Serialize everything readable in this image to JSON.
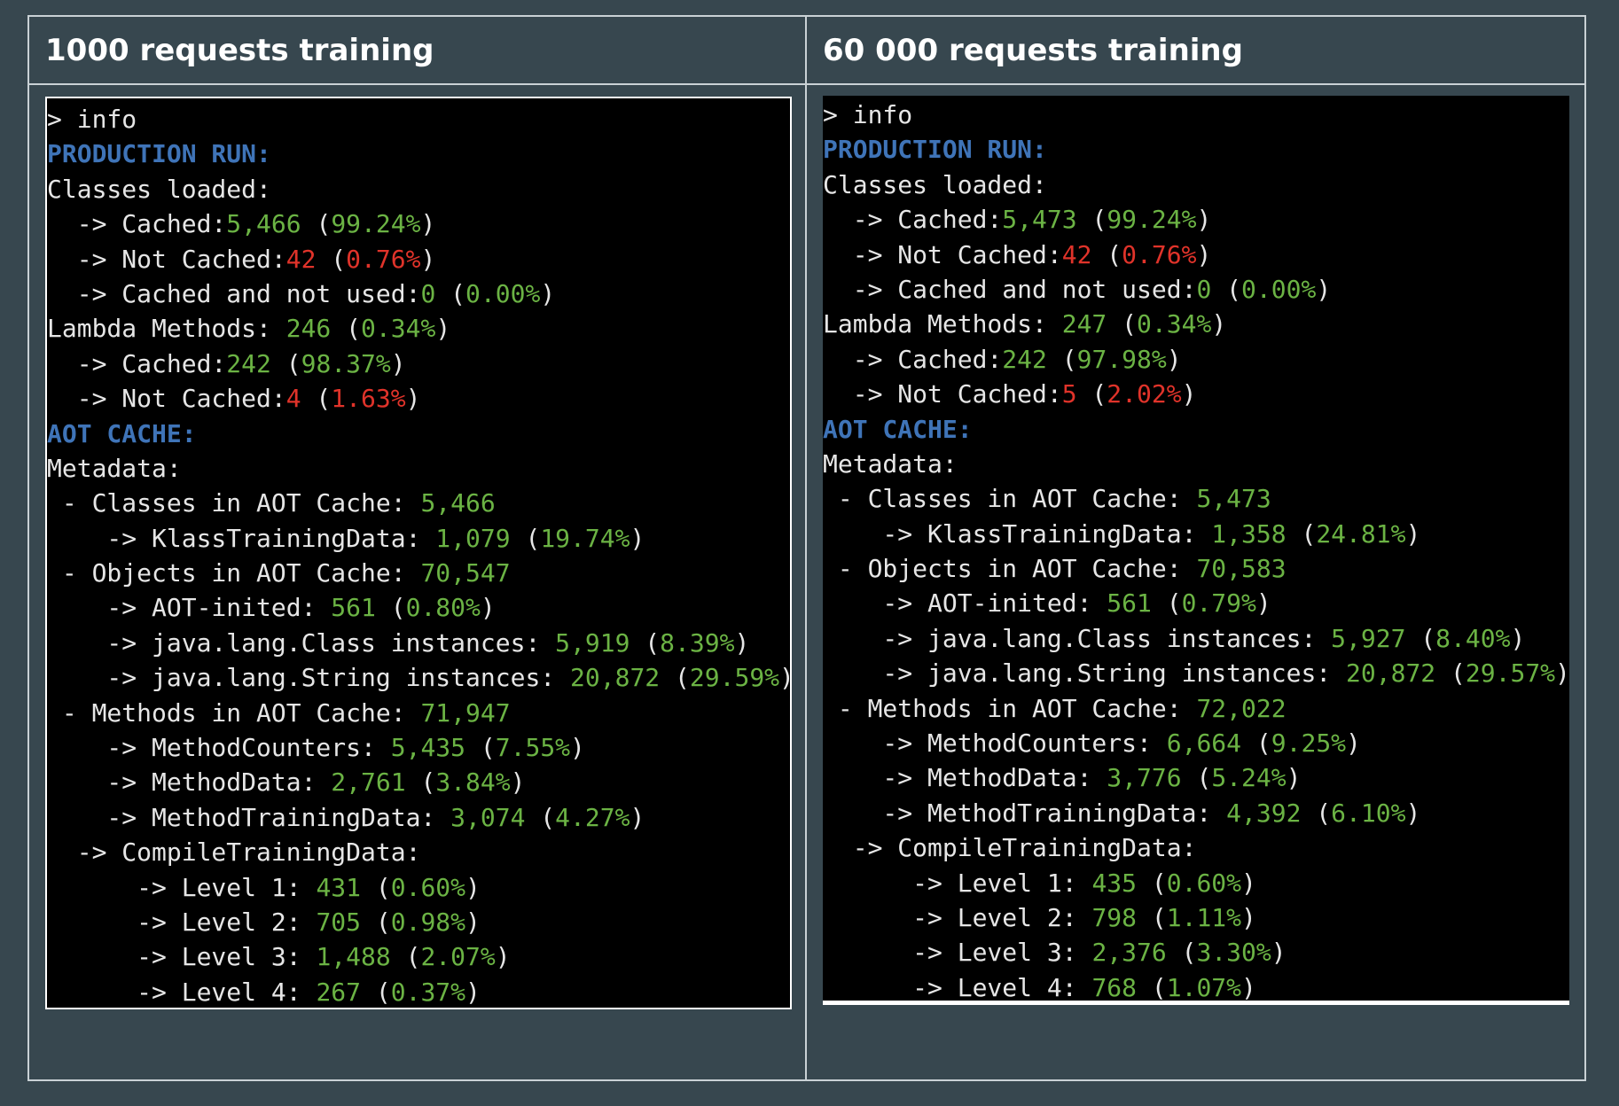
{
  "columns": [
    {
      "header": "1000 requests training",
      "terminal": {
        "prompt": "> info",
        "production_run_heading": "PRODUCTION RUN:",
        "classes_loaded_label": "Classes loaded:",
        "classes_cached_label": "  -> Cached:",
        "classes_cached_value": "5,466",
        "classes_cached_pct": "99.24%",
        "classes_not_cached_label": "  -> Not Cached:",
        "classes_not_cached_value": "42",
        "classes_not_cached_pct": "0.76%",
        "classes_cached_not_used_label": "  -> Cached and not used:",
        "classes_cached_not_used_value": "0",
        "classes_cached_not_used_pct": "0.00%",
        "lambda_label": "Lambda Methods: ",
        "lambda_value": "246",
        "lambda_pct": "0.34%",
        "lambda_cached_label": "  -> Cached:",
        "lambda_cached_value": "242",
        "lambda_cached_pct": "98.37%",
        "lambda_not_cached_label": "  -> Not Cached:",
        "lambda_not_cached_value": "4",
        "lambda_not_cached_pct": "1.63%",
        "aot_cache_heading": "AOT CACHE:",
        "metadata_label": "Metadata:",
        "classes_in_cache_label": " - Classes in AOT Cache: ",
        "classes_in_cache_value": "5,466",
        "klass_training_label": "    -> KlassTrainingData: ",
        "klass_training_value": "1,079",
        "klass_training_pct": "19.74%",
        "objects_in_cache_label": " - Objects in AOT Cache: ",
        "objects_in_cache_value": "70,547",
        "aot_inited_label": "    -> AOT-inited: ",
        "aot_inited_value": "561",
        "aot_inited_pct": "0.80%",
        "class_instances_label": "    -> java.lang.Class instances: ",
        "class_instances_value": "5,919",
        "class_instances_pct": "8.39%",
        "string_instances_label": "    -> java.lang.String instances: ",
        "string_instances_value": "20,872",
        "string_instances_pct": "29.59%",
        "methods_in_cache_label": " - Methods in AOT Cache: ",
        "methods_in_cache_value": "71,947",
        "method_counters_label": "    -> MethodCounters: ",
        "method_counters_value": "5,435",
        "method_counters_pct": "7.55%",
        "method_data_label": "    -> MethodData: ",
        "method_data_value": "2,761",
        "method_data_pct": "3.84%",
        "method_training_label": "    -> MethodTrainingData: ",
        "method_training_value": "3,074",
        "method_training_pct": "4.27%",
        "compile_training_label": "  -> CompileTrainingData:",
        "level1_label": "      -> Level 1: ",
        "level1_value": "431",
        "level1_pct": "0.60%",
        "level2_label": "      -> Level 2: ",
        "level2_value": "705",
        "level2_pct": "0.98%",
        "level3_label": "      -> Level 3: ",
        "level3_value": "1,488",
        "level3_pct": "2.07%",
        "level4_label": "      -> Level 4: ",
        "level4_value": "267",
        "level4_pct": "0.37%"
      }
    },
    {
      "header": "60 000 requests training",
      "terminal": {
        "prompt": "> info",
        "production_run_heading": "PRODUCTION RUN:",
        "classes_loaded_label": "Classes loaded:",
        "classes_cached_label": "  -> Cached:",
        "classes_cached_value": "5,473",
        "classes_cached_pct": "99.24%",
        "classes_not_cached_label": "  -> Not Cached:",
        "classes_not_cached_value": "42",
        "classes_not_cached_pct": "0.76%",
        "classes_cached_not_used_label": "  -> Cached and not used:",
        "classes_cached_not_used_value": "0",
        "classes_cached_not_used_pct": "0.00%",
        "lambda_label": "Lambda Methods: ",
        "lambda_value": "247",
        "lambda_pct": "0.34%",
        "lambda_cached_label": "  -> Cached:",
        "lambda_cached_value": "242",
        "lambda_cached_pct": "97.98%",
        "lambda_not_cached_label": "  -> Not Cached:",
        "lambda_not_cached_value": "5",
        "lambda_not_cached_pct": "2.02%",
        "aot_cache_heading": "AOT CACHE:",
        "metadata_label": "Metadata:",
        "classes_in_cache_label": " - Classes in AOT Cache: ",
        "classes_in_cache_value": "5,473",
        "klass_training_label": "    -> KlassTrainingData: ",
        "klass_training_value": "1,358",
        "klass_training_pct": "24.81%",
        "objects_in_cache_label": " - Objects in AOT Cache: ",
        "objects_in_cache_value": "70,583",
        "aot_inited_label": "    -> AOT-inited: ",
        "aot_inited_value": "561",
        "aot_inited_pct": "0.79%",
        "class_instances_label": "    -> java.lang.Class instances: ",
        "class_instances_value": "5,927",
        "class_instances_pct": "8.40%",
        "string_instances_label": "    -> java.lang.String instances: ",
        "string_instances_value": "20,872",
        "string_instances_pct": "29.57%",
        "methods_in_cache_label": " - Methods in AOT Cache: ",
        "methods_in_cache_value": "72,022",
        "method_counters_label": "    -> MethodCounters: ",
        "method_counters_value": "6,664",
        "method_counters_pct": "9.25%",
        "method_data_label": "    -> MethodData: ",
        "method_data_value": "3,776",
        "method_data_pct": "5.24%",
        "method_training_label": "    -> MethodTrainingData: ",
        "method_training_value": "4,392",
        "method_training_pct": "6.10%",
        "compile_training_label": "  -> CompileTrainingData:",
        "level1_label": "      -> Level 1: ",
        "level1_value": "435",
        "level1_pct": "0.60%",
        "level2_label": "      -> Level 2: ",
        "level2_value": "798",
        "level2_pct": "1.11%",
        "level3_label": "      -> Level 3: ",
        "level3_value": "2,376",
        "level3_pct": "3.30%",
        "level4_label": "      -> Level 4: ",
        "level4_value": "768",
        "level4_pct": "1.07%"
      }
    }
  ]
}
